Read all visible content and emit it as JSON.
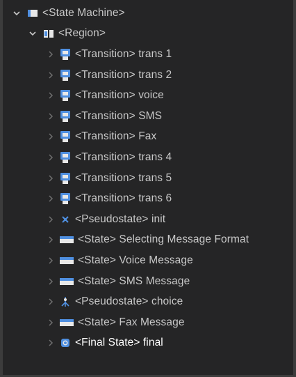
{
  "tree": {
    "root": {
      "label": "<State Machine>",
      "icon": "state-machine-icon",
      "expanded": true
    },
    "region": {
      "label": "<Region>",
      "icon": "region-icon",
      "expanded": true
    },
    "children": [
      {
        "label": "<Transition> trans 1",
        "icon": "transition-icon"
      },
      {
        "label": "<Transition> trans 2",
        "icon": "transition-icon"
      },
      {
        "label": "<Transition> voice",
        "icon": "transition-icon"
      },
      {
        "label": "<Transition> SMS",
        "icon": "transition-icon"
      },
      {
        "label": "<Transition> Fax",
        "icon": "transition-icon"
      },
      {
        "label": "<Transition> trans 4",
        "icon": "transition-icon"
      },
      {
        "label": "<Transition> trans 5",
        "icon": "transition-icon"
      },
      {
        "label": "<Transition> trans 6",
        "icon": "transition-icon"
      },
      {
        "label": "<Pseudostate> init",
        "icon": "pseudostate-initial-icon"
      },
      {
        "label": "<State> Selecting Message Format",
        "icon": "state-icon"
      },
      {
        "label": "<State> Voice Message",
        "icon": "state-icon"
      },
      {
        "label": "<State> SMS Message",
        "icon": "state-icon"
      },
      {
        "label": "<Pseudostate> choice",
        "icon": "pseudostate-choice-icon"
      },
      {
        "label": "<State> Fax Message",
        "icon": "state-icon"
      },
      {
        "label": "<Final State> final",
        "icon": "final-state-icon"
      }
    ]
  },
  "colors": {
    "background": "#252526",
    "text": "#c8c8c8",
    "chevron": "#6e6e6e",
    "icon_blue": "#4f8fe0"
  }
}
